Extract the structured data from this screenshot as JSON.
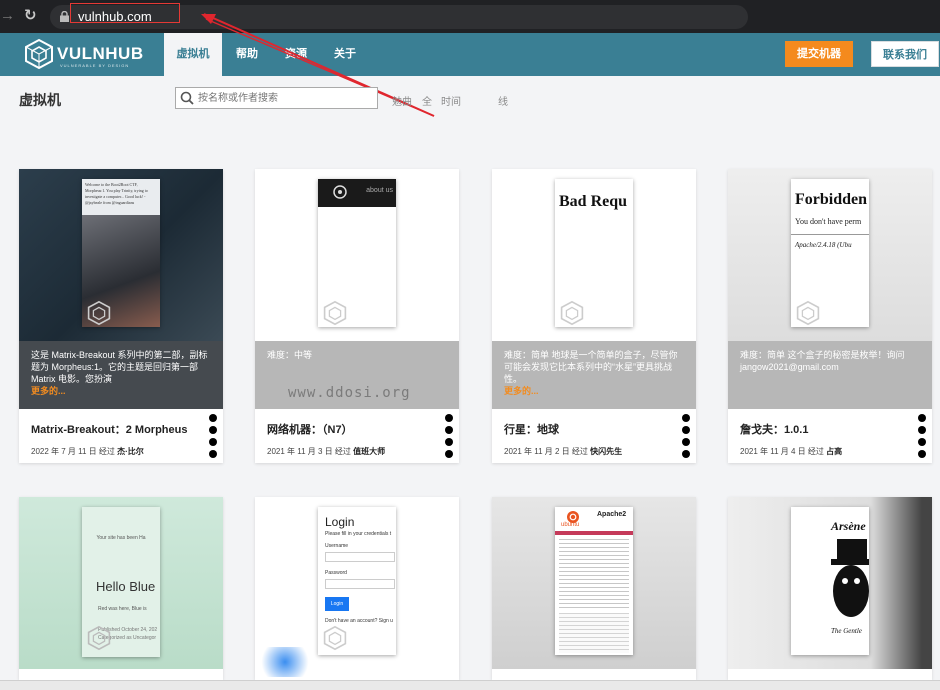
{
  "browser": {
    "url": "vulnhub.com"
  },
  "header": {
    "logo_text": "VULNHUB",
    "logo_sub": "VULNERABLE BY DESIGN",
    "tabs": [
      "虚拟机",
      "帮助",
      "资源",
      "关于"
    ],
    "submit_label": "提交机器",
    "contact_label": "联系我们"
  },
  "filters": {
    "page_title": "虚拟机",
    "search_placeholder": "按名称或作者搜索",
    "options": [
      "勉曲",
      "全",
      "时间",
      "线"
    ]
  },
  "watermark": "www.ddosi.org",
  "cards": [
    {
      "title": "Matrix-Breakout：2 Morpheus",
      "desc": "这是 Matrix-Breakout 系列中的第二部，副标题为 Morpheus:1。它的主题是回归第一部 Matrix 电影。您扮演",
      "more": "更多的...",
      "date": "2022 年 7 月 11 日 经过",
      "author": "杰·比尔",
      "shot_text": "Welcome to the Boot2Root CTF, Morpheus:1. You play Trinity, trying to investigate a computer... Good luck! -@jaybeale from @inguardians"
    },
    {
      "title": "网络机器：（N7）",
      "desc": "难度：中等",
      "more": "",
      "date": "2021 年 11 月 3 日 经过",
      "author": "值班大师",
      "shot_text": "about us"
    },
    {
      "title": "行星：地球",
      "desc": "难度：简单 地球是一个简单的盒子，尽管你可能会发现它比本系列中的“水星”更具挑战性。",
      "more": "更多的...",
      "date": "2021 年 11 月 2 日 经过",
      "author": "快闪先生",
      "shot_text": "Bad Requ"
    },
    {
      "title": "詹戈夫：1.0.1",
      "desc": "难度：简单 这个盒子的秘密是枚举！询问 jangow2021@gmail.com",
      "more": "",
      "date": "2021 年 11 月 4 日 经过",
      "author": "占高",
      "shot_text": "Forbidden",
      "shot_text2": "You don't have perm",
      "shot_text3": "Apache/2.4.18 (Ubu"
    },
    {
      "title": "",
      "desc": "",
      "more": "",
      "date": "",
      "author": "",
      "shot_text": "Hello Blue",
      "shot_text2": "Your site has been Ha",
      "shot_text3": "Red was here, Blue is",
      "shot_text4": "Published October 24, 202 Categorized as Uncategor"
    },
    {
      "title": "",
      "desc": "",
      "more": "",
      "date": "",
      "author": "",
      "shot_text": "Login",
      "shot_text2": "Please fill in your credentials t",
      "shot_text3": "Username",
      "shot_text4": "Password",
      "shot_text5": "Login",
      "shot_text6": "Don't have an account? Sign u"
    },
    {
      "title": "",
      "desc": "",
      "more": "",
      "date": "",
      "author": "",
      "shot_text": "Apache2",
      "shot_text2": "ubuntu"
    },
    {
      "title": "",
      "desc": "",
      "more": "",
      "date": "",
      "author": "",
      "shot_text": "Arsène",
      "shot_text2": "The Gentle"
    }
  ]
}
